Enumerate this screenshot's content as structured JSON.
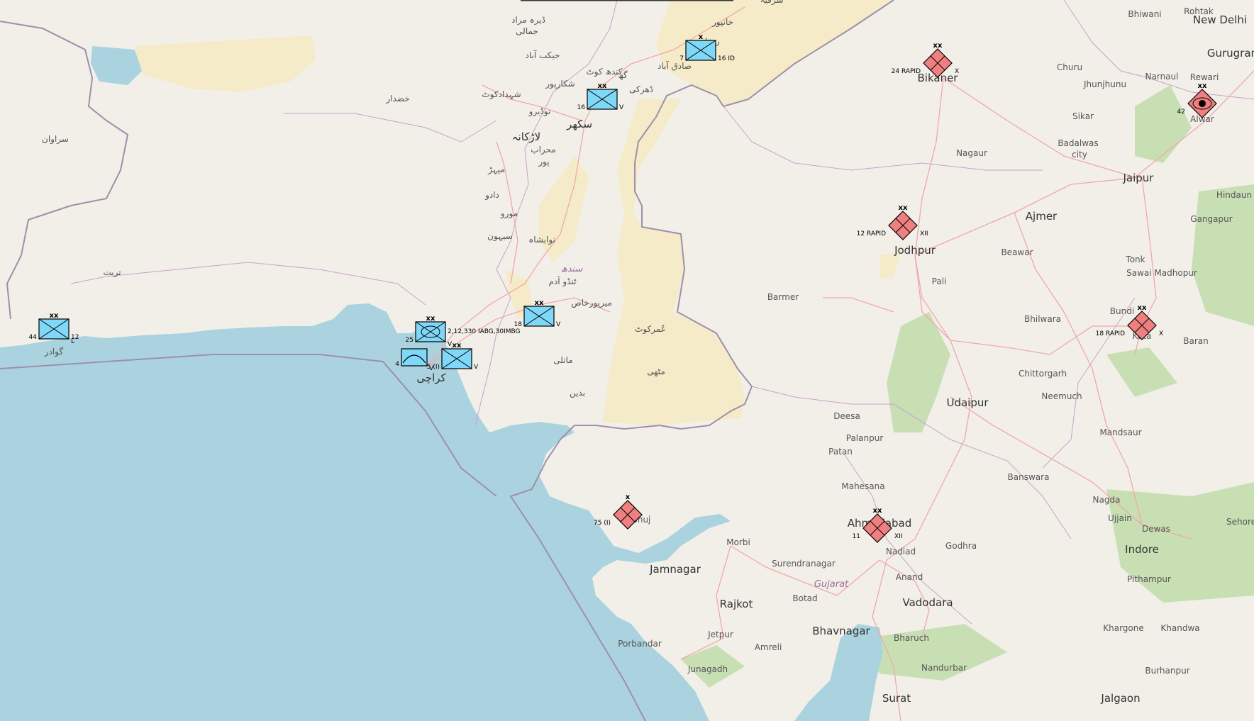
{
  "colors": {
    "land": "#f2efe9",
    "sea": "#aad3df",
    "desert": "#f5ebc8",
    "forest": "#c8dfb4",
    "border": "#9e8fab",
    "road": "#f0a8a8",
    "friendly": "#80d8f8",
    "hostile": "#f08080"
  },
  "places": [
    {
      "id": "new-delhi",
      "name": "New Delhi",
      "cls": "city"
    },
    {
      "id": "bhiwani",
      "name": "Bhiwani",
      "cls": "town"
    },
    {
      "id": "rohtak",
      "name": "Rohtak",
      "cls": "town"
    },
    {
      "id": "gurugram",
      "name": "Gurugram",
      "cls": "city"
    },
    {
      "id": "rewari",
      "name": "Rewari",
      "cls": "town"
    },
    {
      "id": "narnaul",
      "name": "Narnaul",
      "cls": "town"
    },
    {
      "id": "churu",
      "name": "Churu",
      "cls": "town"
    },
    {
      "id": "jhunjhunu",
      "name": "Jhunjhunu",
      "cls": "town"
    },
    {
      "id": "sikar",
      "name": "Sikar",
      "cls": "town"
    },
    {
      "id": "badalwas",
      "name": "Badalwas",
      "cls": "town"
    },
    {
      "id": "city",
      "name": "city",
      "cls": "town"
    },
    {
      "id": "alwar",
      "name": "Alwar",
      "cls": "town"
    },
    {
      "id": "jaipur",
      "name": "Jaipur",
      "cls": "city"
    },
    {
      "id": "hindaun",
      "name": "Hindaun",
      "cls": "town"
    },
    {
      "id": "gangapur",
      "name": "Gangapur",
      "cls": "town"
    },
    {
      "id": "ajmer",
      "name": "Ajmer",
      "cls": "city"
    },
    {
      "id": "tonk",
      "name": "Tonk",
      "cls": "town"
    },
    {
      "id": "sawai",
      "name": "Sawai Madhopur",
      "cls": "town"
    },
    {
      "id": "bundi",
      "name": "Bundi",
      "cls": "town"
    },
    {
      "id": "kota",
      "name": "Kota",
      "cls": "town"
    },
    {
      "id": "baran",
      "name": "Baran",
      "cls": "town"
    },
    {
      "id": "bikaner",
      "name": "Bikaner",
      "cls": "city"
    },
    {
      "id": "nagaur",
      "name": "Nagaur",
      "cls": "town"
    },
    {
      "id": "jodhpur",
      "name": "Jodhpur",
      "cls": "city"
    },
    {
      "id": "beawar",
      "name": "Beawar",
      "cls": "town"
    },
    {
      "id": "pali",
      "name": "Pali",
      "cls": "town"
    },
    {
      "id": "barmer",
      "name": "Barmer",
      "cls": "town"
    },
    {
      "id": "bhilwara",
      "name": "Bhilwara",
      "cls": "town"
    },
    {
      "id": "chittorgarh",
      "name": "Chittorgarh",
      "cls": "town"
    },
    {
      "id": "neemuch",
      "name": "Neemuch",
      "cls": "town"
    },
    {
      "id": "udaipur",
      "name": "Udaipur",
      "cls": "city"
    },
    {
      "id": "mandsaur",
      "name": "Mandsaur",
      "cls": "town"
    },
    {
      "id": "deesa",
      "name": "Deesa",
      "cls": "town"
    },
    {
      "id": "palanpur",
      "name": "Palanpur",
      "cls": "town"
    },
    {
      "id": "patan",
      "name": "Patan",
      "cls": "town"
    },
    {
      "id": "mahesana",
      "name": "Mahesana",
      "cls": "town"
    },
    {
      "id": "banswara",
      "name": "Banswara",
      "cls": "town"
    },
    {
      "id": "nagda",
      "name": "Nagda",
      "cls": "town"
    },
    {
      "id": "ujjain",
      "name": "Ujjain",
      "cls": "town"
    },
    {
      "id": "dewas",
      "name": "Dewas",
      "cls": "town"
    },
    {
      "id": "sehore",
      "name": "Sehore",
      "cls": "town"
    },
    {
      "id": "indore",
      "name": "Indore",
      "cls": "city"
    },
    {
      "id": "pithampur",
      "name": "Pithampur",
      "cls": "town"
    },
    {
      "id": "khargone",
      "name": "Khargone",
      "cls": "town"
    },
    {
      "id": "khandwa",
      "name": "Khandwa",
      "cls": "town"
    },
    {
      "id": "burhanpur",
      "name": "Burhanpur",
      "cls": "town"
    },
    {
      "id": "jalgaon",
      "name": "Jalgaon",
      "cls": "city"
    },
    {
      "id": "nandurbar",
      "name": "Nandurbar",
      "cls": "town"
    },
    {
      "id": "ahmedabad",
      "name": "Ahmedabad",
      "cls": "city"
    },
    {
      "id": "nadiad",
      "name": "Nadiad",
      "cls": "town"
    },
    {
      "id": "godhra",
      "name": "Godhra",
      "cls": "town"
    },
    {
      "id": "anand",
      "name": "Anand",
      "cls": "town"
    },
    {
      "id": "vadodara",
      "name": "Vadodara",
      "cls": "city"
    },
    {
      "id": "gujarat",
      "name": "Gujarat",
      "cls": "region"
    },
    {
      "id": "surendranagar",
      "name": "Surendranagar",
      "cls": "town"
    },
    {
      "id": "botad",
      "name": "Botad",
      "cls": "town"
    },
    {
      "id": "bhavnagar",
      "name": "Bhavnagar",
      "cls": "city"
    },
    {
      "id": "bharuch",
      "name": "Bharuch",
      "cls": "town"
    },
    {
      "id": "surat",
      "name": "Surat",
      "cls": "city"
    },
    {
      "id": "morbi",
      "name": "Morbi",
      "cls": "town"
    },
    {
      "id": "jamnagar",
      "name": "Jamnagar",
      "cls": "city"
    },
    {
      "id": "rajkot",
      "name": "Rajkot",
      "cls": "city"
    },
    {
      "id": "jetpur",
      "name": "Jetpur",
      "cls": "town"
    },
    {
      "id": "amreli",
      "name": "Amreli",
      "cls": "town"
    },
    {
      "id": "porbandar",
      "name": "Porbandar",
      "cls": "town"
    },
    {
      "id": "junagadh",
      "name": "Junagadh",
      "cls": "town"
    },
    {
      "id": "bhuj",
      "name": "Bhuj",
      "cls": "town"
    },
    {
      "id": "karachi",
      "name": "کراچی",
      "cls": "city"
    },
    {
      "id": "sukkur",
      "name": "سکھر",
      "cls": "city"
    },
    {
      "id": "larkana",
      "name": "لاڑکانہ",
      "cls": "city"
    },
    {
      "id": "sindh",
      "name": "سندھ",
      "cls": "region"
    },
    {
      "id": "gwadar",
      "name": "گوادر",
      "cls": "town"
    },
    {
      "id": "turbat",
      "name": "تربت",
      "cls": "town"
    },
    {
      "id": "khuzdar",
      "name": "خضدار",
      "cls": "town"
    },
    {
      "id": "saravan",
      "name": "سراوان",
      "cls": "town"
    },
    {
      "id": "dera-murad",
      "name": "ڈیرہ مراد",
      "cls": "town"
    },
    {
      "id": "jamali",
      "name": "جمالی",
      "cls": "town"
    },
    {
      "id": "jacobabad",
      "name": "جیکب آباد",
      "cls": "town"
    },
    {
      "id": "kandhkot",
      "name": "کندھ کوٹ",
      "cls": "town"
    },
    {
      "id": "shikarpur",
      "name": "شکارپور",
      "cls": "town"
    },
    {
      "id": "shahdadkot",
      "name": "شہدادکوٹ",
      "cls": "town"
    },
    {
      "id": "naudero",
      "name": "نوڈیرو",
      "cls": "town"
    },
    {
      "id": "mehrabpur",
      "name": "محراب",
      "cls": "town"
    },
    {
      "id": "pur",
      "name": "پور",
      "cls": "town"
    },
    {
      "id": "mehar",
      "name": "میہڑ",
      "cls": "town"
    },
    {
      "id": "dadu",
      "name": "دادو",
      "cls": "town"
    },
    {
      "id": "moro",
      "name": "مورو",
      "cls": "town"
    },
    {
      "id": "sehwan",
      "name": "سیہون",
      "cls": "town"
    },
    {
      "id": "nawabshah",
      "name": "نوابشاہ",
      "cls": "town"
    },
    {
      "id": "tando-adam",
      "name": "ٹنڈو آدم",
      "cls": "town"
    },
    {
      "id": "mirpur-khas",
      "name": "میرپورخاص",
      "cls": "town"
    },
    {
      "id": "umerkot",
      "name": "عُمرکوٹ",
      "cls": "town"
    },
    {
      "id": "matli",
      "name": "ماتلی",
      "cls": "town"
    },
    {
      "id": "mithi",
      "name": "مٹھی",
      "cls": "town"
    },
    {
      "id": "badin",
      "name": "بدین",
      "cls": "town"
    },
    {
      "id": "ghotki",
      "name": "ڈھرکی",
      "cls": "town"
    },
    {
      "id": "sadiqabad",
      "name": "صادق آباد",
      "cls": "town"
    },
    {
      "id": "khanpur",
      "name": "خانپور",
      "cls": "town"
    },
    {
      "id": "sharqia",
      "name": "شرقیہ",
      "cls": "town"
    },
    {
      "id": "rahim-khan",
      "name": "ر خان",
      "cls": "town"
    },
    {
      "id": "ghotki-2",
      "name": "گھ",
      "cls": "town"
    }
  ],
  "units": [
    {
      "id": "pk-44",
      "side": "friendly",
      "echelon": "xx",
      "type": "infantry",
      "left": "44",
      "right": "12",
      "sub": "L"
    },
    {
      "id": "pk-25",
      "side": "friendly",
      "echelon": "xx",
      "type": "armor-infantry",
      "left": "25",
      "right": "2,12,330 IABG,30IMBG",
      "sub": "V"
    },
    {
      "id": "pk-4",
      "side": "friendly",
      "echelon": "",
      "type": "air",
      "left": "4",
      "right": "",
      "sub": "V"
    },
    {
      "id": "pk-5",
      "side": "friendly",
      "echelon": "xx",
      "type": "infantry",
      "left": "5 (I)",
      "right": "V",
      "sub": ""
    },
    {
      "id": "pk-18",
      "side": "friendly",
      "echelon": "xx",
      "type": "infantry",
      "left": "18",
      "right": "V",
      "sub": ""
    },
    {
      "id": "pk-16",
      "side": "friendly",
      "echelon": "xx",
      "type": "infantry",
      "left": "16",
      "right": "V",
      "sub": ""
    },
    {
      "id": "pk-7",
      "side": "friendly",
      "echelon": "x",
      "type": "infantry",
      "left": "7",
      "right": "16 ID",
      "sub": ""
    },
    {
      "id": "in-24",
      "side": "hostile",
      "echelon": "xx",
      "type": "infantry",
      "left": "24 RAPID",
      "right": "X",
      "sub": ""
    },
    {
      "id": "in-12",
      "side": "hostile",
      "echelon": "xx",
      "type": "infantry",
      "left": "12 RAPID",
      "right": "XII",
      "sub": ""
    },
    {
      "id": "in-42",
      "side": "hostile",
      "echelon": "xx",
      "type": "artillery",
      "left": "42",
      "right": "",
      "sub": ""
    },
    {
      "id": "in-18",
      "side": "hostile",
      "echelon": "xx",
      "type": "infantry",
      "left": "18 RAPID",
      "right": "X",
      "sub": ""
    },
    {
      "id": "in-75",
      "side": "hostile",
      "echelon": "x",
      "type": "infantry",
      "left": "75 (I)",
      "right": "",
      "sub": ""
    },
    {
      "id": "in-11",
      "side": "hostile",
      "echelon": "xx",
      "type": "infantry",
      "left": "11",
      "right": "XII",
      "sub": ""
    }
  ]
}
